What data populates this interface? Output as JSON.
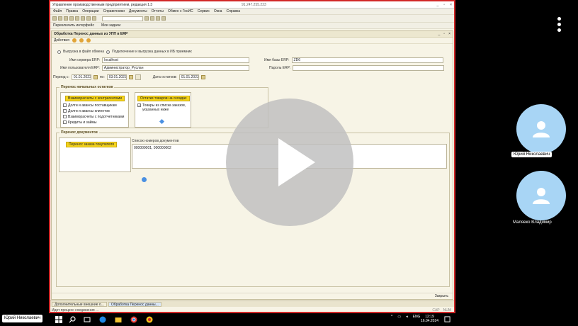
{
  "app": {
    "title": "Управление производственным предприятием, редакция 1.3",
    "ip": "91.247.255.223",
    "menu": [
      "Файл",
      "Правка",
      "Операции",
      "Справочники",
      "Документы",
      "Отчеты",
      "Обмен с ГосИС",
      "Сервис",
      "Окна",
      "Справка"
    ],
    "panel_items": [
      "Переключить интерфейс",
      "Мои задачи"
    ]
  },
  "doc": {
    "title": "Обработка  Перенос данных из УПП в ERP",
    "actions_label": "Действия",
    "mode_export": "Выгрузка в файл обмена",
    "mode_connect": "Подключение и выгрузка данных в ИБ приемник",
    "server_label": "Имя сервера ERP:",
    "server_value": "localhost",
    "db_label": "Имя базы ERP:",
    "db_value": "ZD6",
    "user_label": "Имя пользователя ERP:",
    "user_value": "Администратор_Руслан",
    "pass_label": "Пароль ERP:",
    "pass_value": "",
    "period_label": "Период с:",
    "period_from": "01.01.2023",
    "period_to_label": "по:",
    "period_to": "03.01.2023",
    "balance_date_label": "Дата остатков:",
    "balance_date": "01.01.2023"
  },
  "balances": {
    "title": "Перенос начальных остатков",
    "settlements_btn": "Взаиморасчеты с контрагентами",
    "items": [
      {
        "label": "Долги и авансы поставщикам",
        "checked": false
      },
      {
        "label": "Долги и авансы клиентов",
        "checked": false
      },
      {
        "label": "Взаиморасчеты с подотчетниками",
        "checked": false
      },
      {
        "label": "Кредиты и займы",
        "checked": false
      }
    ],
    "stock_btn": "Остатки товаров на складах",
    "stock_item": "Товары из списка заказов, указанных ниже",
    "stock_checked": true
  },
  "documents": {
    "title": "Перенос документов",
    "orders_btn": "Перенос заказа покупателя",
    "list_label": "Список номеров документов",
    "list_value": "000000001, 000000002"
  },
  "footer": {
    "close_label": "Закрыть",
    "tab1": "Дополнительные внешние о...",
    "tab2": "Обработка  Перенос данны...",
    "status": "Идет процесс соединения ...",
    "cap": "CAP",
    "num": "NUM"
  },
  "call": {
    "participant1": "Юрий Николаевич",
    "participant2": "Маляеко Владимир",
    "self_tag": "Юрий Николаевич"
  },
  "os": {
    "lang": "ENG",
    "time": "12:19",
    "date": "16.04.2024"
  },
  "colors": {
    "accent_border": "#d22828",
    "yellow_button": "#f5d41c",
    "avatar_bg": "#a8d5f5"
  }
}
